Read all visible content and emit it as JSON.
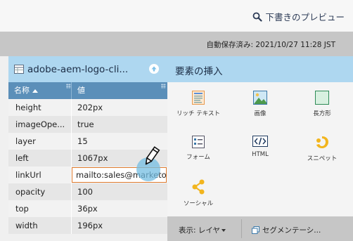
{
  "header": {
    "preview_label": "下書きのプレビュー",
    "preview_icon": "search-icon"
  },
  "status": {
    "autosave": "自動保存済み: 2021/10/27 11:28 JST"
  },
  "properties_panel": {
    "title": "adobe-aem-logo-cli...",
    "columns": {
      "name": "名称",
      "value": "値"
    },
    "rows": [
      {
        "key": "height",
        "value": "202px"
      },
      {
        "key": "imageOpe...",
        "value": "true"
      },
      {
        "key": "layer",
        "value": "15"
      },
      {
        "key": "left",
        "value": "1067px"
      },
      {
        "key": "linkUrl",
        "value": "mailto:sales@marketo"
      },
      {
        "key": "opacity",
        "value": "100"
      },
      {
        "key": "top",
        "value": "36px"
      },
      {
        "key": "width",
        "value": "196px"
      }
    ]
  },
  "insert_panel": {
    "title": "要素の挿入",
    "elements": [
      {
        "label": "リッチ テキスト",
        "icon": "rich-text-icon"
      },
      {
        "label": "画像",
        "icon": "image-icon"
      },
      {
        "label": "長方形",
        "icon": "rectangle-icon"
      },
      {
        "label": "フォーム",
        "icon": "form-icon"
      },
      {
        "label": "HTML",
        "icon": "html-icon"
      },
      {
        "label": "スニペット",
        "icon": "snippet-icon"
      },
      {
        "label": "ソーシャル",
        "icon": "social-share-icon"
      }
    ]
  },
  "bottom_bar": {
    "view_label": "表示: レイヤ",
    "segmentation_label": "セグメンテーシ..."
  },
  "colors": {
    "header_blue": "#aed7f0",
    "table_header": "#5b8fb9",
    "edit_border": "#e07b2e",
    "gray_bar": "#c6c6c6"
  }
}
